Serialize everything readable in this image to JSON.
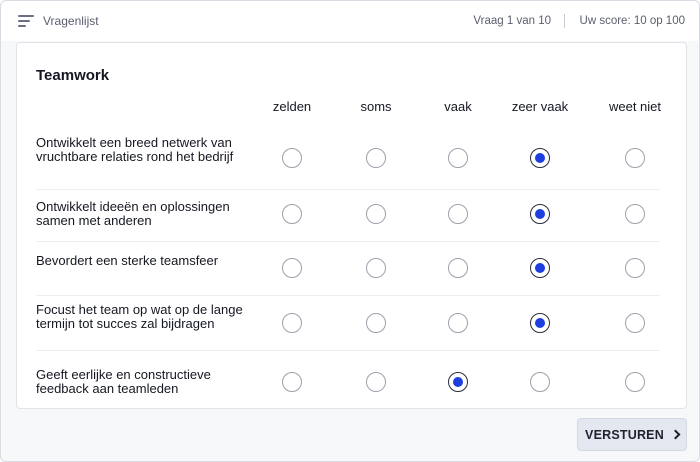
{
  "header": {
    "title": "Vragenlijst",
    "progress": "Vraag 1 van 10",
    "score": "Uw score: 10 op 100"
  },
  "section": {
    "title": "Teamwork",
    "columns": [
      "zelden",
      "soms",
      "vaak",
      "zeer vaak",
      "weet niet"
    ]
  },
  "questions": [
    {
      "label": "Ontwikkelt een breed netwerk van vruchtbare relaties rond het bedrijf",
      "selected": "zeer vaak"
    },
    {
      "label": "Ontwikkelt ideeën en oplossingen samen met anderen",
      "selected": "zeer vaak"
    },
    {
      "label": "Bevordert een sterke teamsfeer",
      "selected": "zeer vaak"
    },
    {
      "label": "Focust het team op wat op de lange termijn tot succes zal bijdragen",
      "selected": "zeer vaak"
    },
    {
      "label": "Geeft eerlijke en constructieve feedback aan teamleden",
      "selected": "vaak"
    }
  ],
  "footer": {
    "submit_label": "VERSTUREN"
  },
  "colors": {
    "accent": "#1d3fe0",
    "submit_bg": "#e3e7f0"
  },
  "icons": {
    "menu": "menu-lines-icon",
    "submit": "chevron-right-icon"
  }
}
